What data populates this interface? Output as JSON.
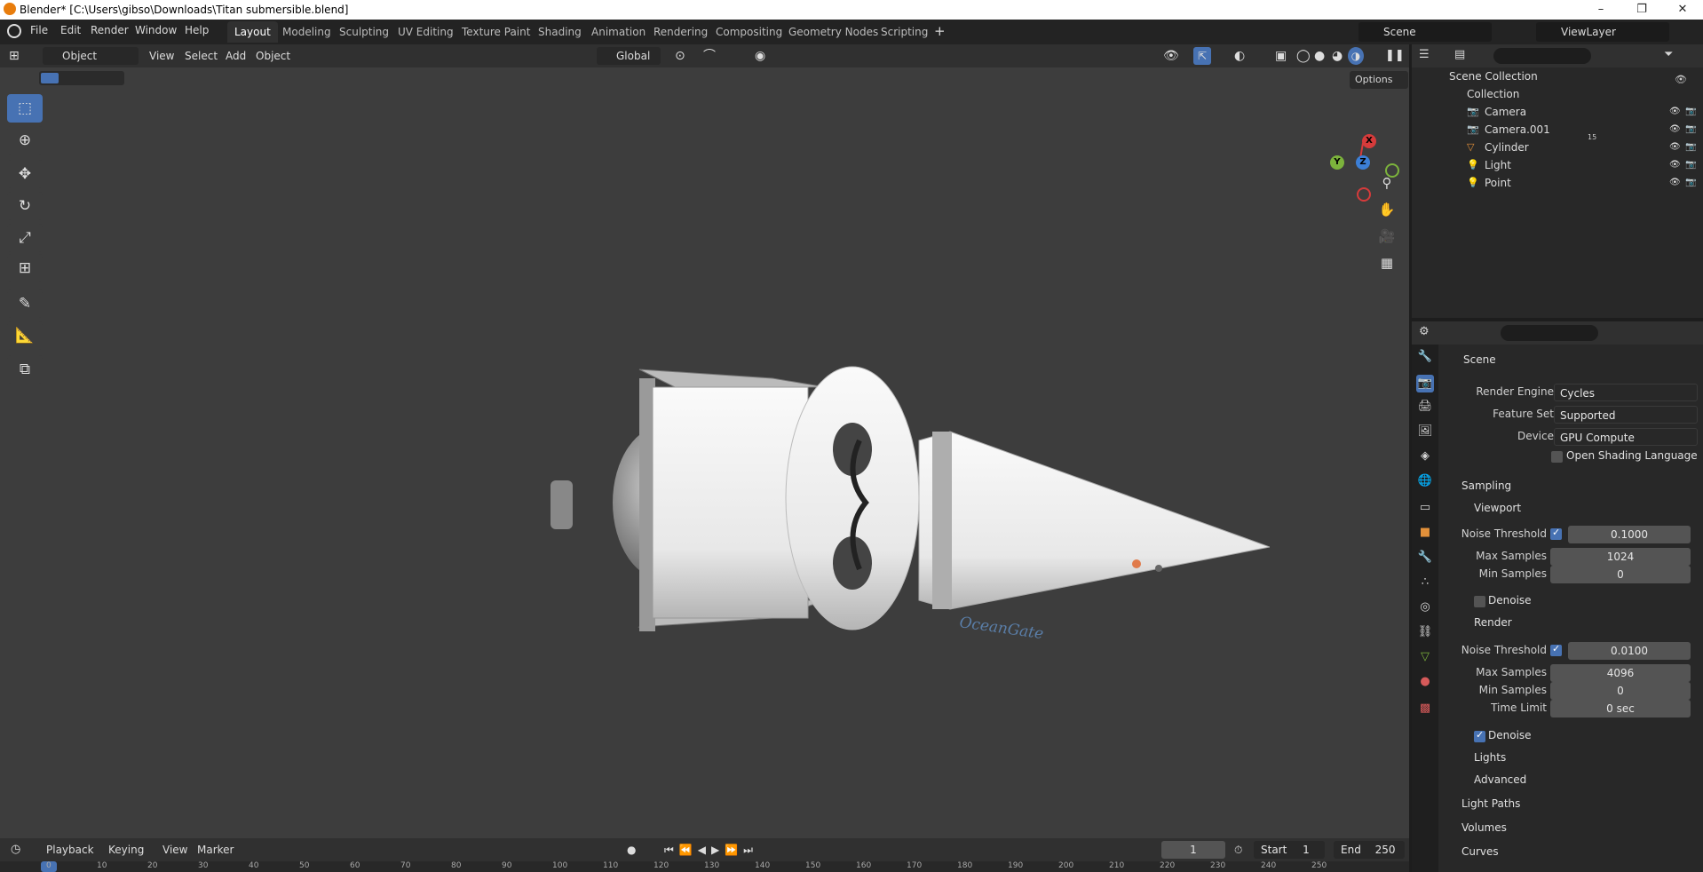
{
  "window": {
    "title": "Blender* [C:\\Users\\gibso\\Downloads\\Titan submersible.blend]",
    "minimize": "–",
    "maximize": "❐",
    "close": "✕"
  },
  "menus": [
    "File",
    "Edit",
    "Render",
    "Window",
    "Help"
  ],
  "workspaces": [
    "Layout",
    "Modeling",
    "Sculpting",
    "UV Editing",
    "Texture Paint",
    "Shading",
    "Animation",
    "Rendering",
    "Compositing",
    "Geometry Nodes",
    "Scripting"
  ],
  "scene_name": "Scene",
  "view_layer": "ViewLayer",
  "viewport_header": {
    "mode": "Object Mode",
    "view": "View",
    "select": "Select",
    "add": "Add",
    "object": "Object",
    "transform": "Global",
    "options": "Options"
  },
  "gizmo": {
    "x": "X",
    "y": "Y",
    "z": "Z"
  },
  "outliner": {
    "scene_collection": "Scene Collection",
    "collection": "Collection",
    "items": [
      {
        "name": "Camera",
        "icon": "camera-icon",
        "color": "#e3913a"
      },
      {
        "name": "Camera.001",
        "icon": "camera-icon",
        "color": "#e3913a"
      },
      {
        "name": "Cylinder",
        "icon": "mesh-icon",
        "color": "#e3913a"
      },
      {
        "name": "Light",
        "icon": "light-icon",
        "color": "#e3913a"
      },
      {
        "name": "Point",
        "icon": "light-icon",
        "color": "#e3913a"
      }
    ],
    "extra_badge": "15"
  },
  "properties": {
    "title": "Scene",
    "render_engine_label": "Render Engine",
    "render_engine": "Cycles",
    "feature_set_label": "Feature Set",
    "feature_set": "Supported",
    "device_label": "Device",
    "device": "GPU Compute",
    "osl_label": "Open Shading Language",
    "sampling": "Sampling",
    "viewport": "Viewport",
    "vp_noise_label": "Noise Threshold",
    "vp_noise": "0.1000",
    "vp_max_label": "Max Samples",
    "vp_max": "1024",
    "vp_min_label": "Min Samples",
    "vp_min": "0",
    "denoise": "Denoise",
    "render": "Render",
    "r_noise_label": "Noise Threshold",
    "r_noise": "0.0100",
    "r_max_label": "Max Samples",
    "r_max": "4096",
    "r_min_label": "Min Samples",
    "r_min": "0",
    "time_limit_label": "Time Limit",
    "time_limit": "0 sec",
    "denoise2": "Denoise",
    "lights": "Lights",
    "advanced": "Advanced",
    "light_paths": "Light Paths",
    "volumes": "Volumes",
    "curves": "Curves"
  },
  "model": {
    "brand": "OceanGate"
  },
  "timeline": {
    "playback": "Playback",
    "keying": "Keying",
    "view": "View",
    "marker": "Marker",
    "frame": "1",
    "start_label": "Start",
    "start": "1",
    "end_label": "End",
    "end": "250",
    "ticks": [
      "0",
      "10",
      "20",
      "30",
      "40",
      "50",
      "60",
      "70",
      "80",
      "90",
      "100",
      "110",
      "120",
      "130",
      "140",
      "150",
      "160",
      "170",
      "180",
      "190",
      "200",
      "210",
      "220",
      "230",
      "240",
      "250"
    ]
  }
}
